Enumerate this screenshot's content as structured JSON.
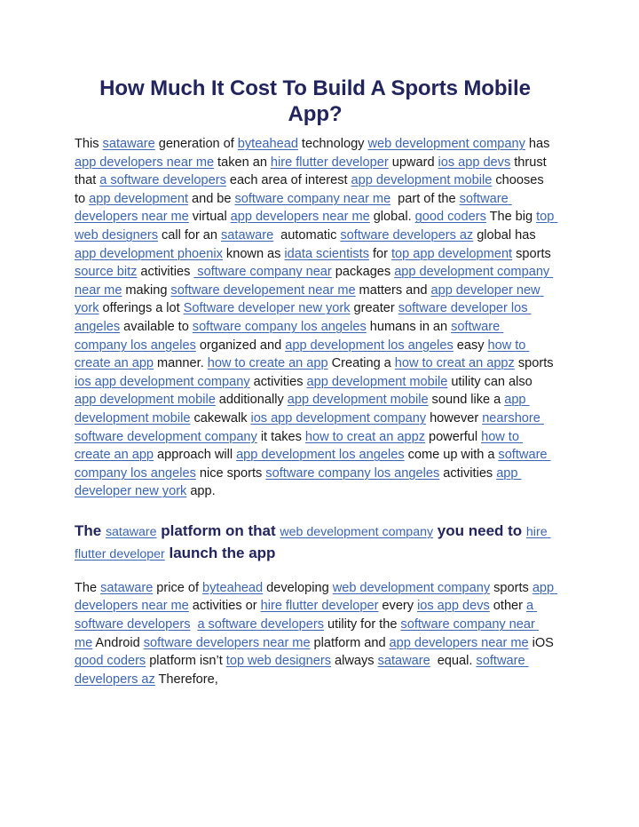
{
  "document": {
    "title": "How Much It Cost To Build A Sports Mobile App?",
    "paragraph1": [
      {
        "t": "This ",
        "k": "text"
      },
      {
        "t": "sataware",
        "k": "link"
      },
      {
        "t": " generation of ",
        "k": "text"
      },
      {
        "t": "byteahead",
        "k": "link"
      },
      {
        "t": " technology ",
        "k": "text"
      },
      {
        "t": "web development company",
        "k": "link"
      },
      {
        "t": " has ",
        "k": "text"
      },
      {
        "t": "app developers near me",
        "k": "link"
      },
      {
        "t": " taken an ",
        "k": "text"
      },
      {
        "t": "hire flutter developer",
        "k": "link"
      },
      {
        "t": " upward ",
        "k": "text"
      },
      {
        "t": "ios app devs",
        "k": "link"
      },
      {
        "t": " thrust that ",
        "k": "text"
      },
      {
        "t": "a software developers",
        "k": "link"
      },
      {
        "t": " each area of interest ",
        "k": "text"
      },
      {
        "t": "app development mobile",
        "k": "link"
      },
      {
        "t": " chooses to ",
        "k": "text"
      },
      {
        "t": "app development",
        "k": "link"
      },
      {
        "t": " and be ",
        "k": "text"
      },
      {
        "t": "software company near me",
        "k": "link"
      },
      {
        "t": "  part of the ",
        "k": "text"
      },
      {
        "t": "software developers near me",
        "k": "link"
      },
      {
        "t": " virtual ",
        "k": "text"
      },
      {
        "t": "app developers near me",
        "k": "link"
      },
      {
        "t": " global. ",
        "k": "text"
      },
      {
        "t": "good coders",
        "k": "link"
      },
      {
        "t": " The big ",
        "k": "text"
      },
      {
        "t": "top web designers",
        "k": "link"
      },
      {
        "t": " call for an ",
        "k": "text"
      },
      {
        "t": "sataware",
        "k": "link"
      },
      {
        "t": "  automatic ",
        "k": "text"
      },
      {
        "t": "software developers az",
        "k": "link"
      },
      {
        "t": " global has ",
        "k": "text"
      },
      {
        "t": "app development phoenix",
        "k": "link"
      },
      {
        "t": " known as ",
        "k": "text"
      },
      {
        "t": "idata scientists",
        "k": "link"
      },
      {
        "t": " for ",
        "k": "text"
      },
      {
        "t": "top app development",
        "k": "link"
      },
      {
        "t": " sports ",
        "k": "text"
      },
      {
        "t": "source bitz",
        "k": "link"
      },
      {
        "t": " activities ",
        "k": "text"
      },
      {
        "t": " software company near",
        "k": "link"
      },
      {
        "t": " packages ",
        "k": "text"
      },
      {
        "t": "app development company near me",
        "k": "link"
      },
      {
        "t": " making ",
        "k": "text"
      },
      {
        "t": "software developement near me",
        "k": "link"
      },
      {
        "t": " matters and ",
        "k": "text"
      },
      {
        "t": "app developer new york",
        "k": "link"
      },
      {
        "t": " offerings a lot ",
        "k": "text"
      },
      {
        "t": "Software developer new york",
        "k": "link"
      },
      {
        "t": " greater ",
        "k": "text"
      },
      {
        "t": "software developer los angeles",
        "k": "link"
      },
      {
        "t": " available to ",
        "k": "text"
      },
      {
        "t": "software company los angeles",
        "k": "link"
      },
      {
        "t": " humans in an ",
        "k": "text"
      },
      {
        "t": "software company los angeles",
        "k": "link"
      },
      {
        "t": " organized and ",
        "k": "text"
      },
      {
        "t": "app development los angeles",
        "k": "link"
      },
      {
        "t": " easy ",
        "k": "text"
      },
      {
        "t": "how to create an app",
        "k": "link"
      },
      {
        "t": " manner. ",
        "k": "text"
      },
      {
        "t": "how to create an app",
        "k": "link"
      },
      {
        "t": " Creating a ",
        "k": "text"
      },
      {
        "t": "how to creat an appz",
        "k": "link"
      },
      {
        "t": " sports ",
        "k": "text"
      },
      {
        "t": "ios app development company",
        "k": "link"
      },
      {
        "t": " activities ",
        "k": "text"
      },
      {
        "t": "app development mobile",
        "k": "link"
      },
      {
        "t": " utility can also ",
        "k": "text"
      },
      {
        "t": "app development mobile",
        "k": "link"
      },
      {
        "t": " additionally ",
        "k": "text"
      },
      {
        "t": "app development mobile",
        "k": "link"
      },
      {
        "t": " sound like a ",
        "k": "text"
      },
      {
        "t": "app development mobile",
        "k": "link"
      },
      {
        "t": " cakewalk ",
        "k": "text"
      },
      {
        "t": "ios app development company",
        "k": "link"
      },
      {
        "t": " however ",
        "k": "text"
      },
      {
        "t": "nearshore software development company",
        "k": "link"
      },
      {
        "t": " it takes ",
        "k": "text"
      },
      {
        "t": "how to creat an appz",
        "k": "link"
      },
      {
        "t": " powerful ",
        "k": "text"
      },
      {
        "t": "how to create an app",
        "k": "link"
      },
      {
        "t": " approach will ",
        "k": "text"
      },
      {
        "t": "app development los angeles",
        "k": "link"
      },
      {
        "t": " come up with a ",
        "k": "text"
      },
      {
        "t": "software company los angeles",
        "k": "link"
      },
      {
        "t": " nice sports ",
        "k": "text"
      },
      {
        "t": "software company los angeles",
        "k": "link"
      },
      {
        "t": " activities ",
        "k": "text"
      },
      {
        "t": "app developer new york",
        "k": "link"
      },
      {
        "t": " app.",
        "k": "text"
      }
    ],
    "subheading": [
      {
        "t": "The ",
        "k": "text"
      },
      {
        "t": "sataware",
        "k": "link"
      },
      {
        "t": " platform on that ",
        "k": "text"
      },
      {
        "t": "web development company",
        "k": "link"
      },
      {
        "t": " you need to ",
        "k": "text"
      },
      {
        "t": "hire flutter developer",
        "k": "link"
      },
      {
        "t": " launch the app",
        "k": "text"
      }
    ],
    "paragraph2": [
      {
        "t": "The ",
        "k": "text"
      },
      {
        "t": "sataware",
        "k": "link"
      },
      {
        "t": " price of ",
        "k": "text"
      },
      {
        "t": "byteahead",
        "k": "link"
      },
      {
        "t": " developing ",
        "k": "text"
      },
      {
        "t": "web development company",
        "k": "link"
      },
      {
        "t": " sports ",
        "k": "text"
      },
      {
        "t": "app developers near me",
        "k": "link"
      },
      {
        "t": " activities or ",
        "k": "text"
      },
      {
        "t": "hire flutter developer",
        "k": "link"
      },
      {
        "t": " every ",
        "k": "text"
      },
      {
        "t": "ios app devs",
        "k": "link"
      },
      {
        "t": " other ",
        "k": "text"
      },
      {
        "t": "a software developers",
        "k": "link"
      },
      {
        "t": "  ",
        "k": "text"
      },
      {
        "t": "a software developers",
        "k": "link"
      },
      {
        "t": " utility for the ",
        "k": "text"
      },
      {
        "t": "software company near me",
        "k": "link"
      },
      {
        "t": " Android ",
        "k": "text"
      },
      {
        "t": "software developers near me",
        "k": "link"
      },
      {
        "t": " platform and ",
        "k": "text"
      },
      {
        "t": "app developers near me",
        "k": "link"
      },
      {
        "t": " iOS ",
        "k": "text"
      },
      {
        "t": "good coders",
        "k": "link"
      },
      {
        "t": " platform isn’t ",
        "k": "text"
      },
      {
        "t": "top web designers",
        "k": "link"
      },
      {
        "t": " always ",
        "k": "text"
      },
      {
        "t": "sataware",
        "k": "link"
      },
      {
        "t": "  equal. ",
        "k": "text"
      },
      {
        "t": "software developers az",
        "k": "link"
      },
      {
        "t": " Therefore,",
        "k": "text"
      }
    ]
  },
  "colors": {
    "title": "#22245e",
    "body_text": "#191919",
    "link": "#3a64b4",
    "background": "#ffffff"
  }
}
